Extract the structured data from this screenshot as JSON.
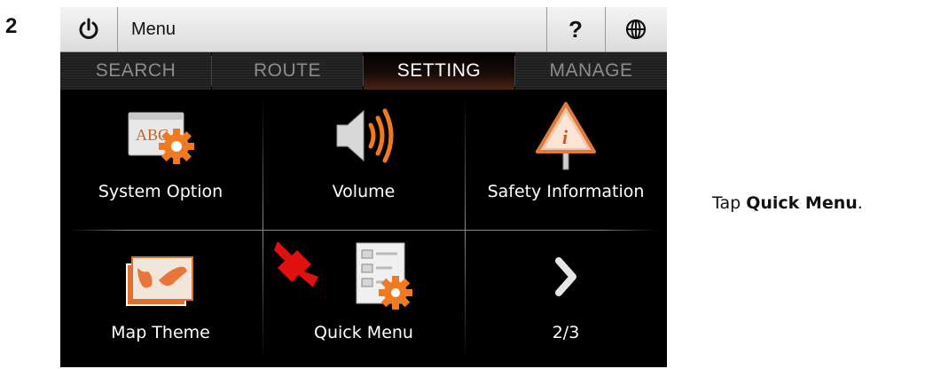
{
  "step": {
    "number": "2"
  },
  "topbar": {
    "power_icon": "power-icon",
    "title": "Menu",
    "help_label": "?",
    "globe_icon": "globe-icon"
  },
  "tabs": [
    {
      "label": "SEARCH",
      "active": false
    },
    {
      "label": "ROUTE",
      "active": false
    },
    {
      "label": "SETTING",
      "active": true
    },
    {
      "label": "MANAGE",
      "active": false
    }
  ],
  "tiles": [
    {
      "label": "System Option",
      "icon": "system-option-icon"
    },
    {
      "label": "Volume",
      "icon": "volume-icon"
    },
    {
      "label": "Safety Information",
      "icon": "safety-info-icon"
    },
    {
      "label": "Map Theme",
      "icon": "map-theme-icon"
    },
    {
      "label": "Quick Menu",
      "icon": "quick-menu-icon"
    },
    {
      "label": "2/3",
      "icon": "next-page-icon"
    }
  ],
  "system_option_icon_text": "ABC",
  "instruction": {
    "prefix": "Tap ",
    "emphasis": "Quick Menu",
    "suffix": "."
  },
  "colors": {
    "accent_orange": "#f07a22",
    "pointer_red": "#e01010",
    "screen_bg": "#000000"
  }
}
